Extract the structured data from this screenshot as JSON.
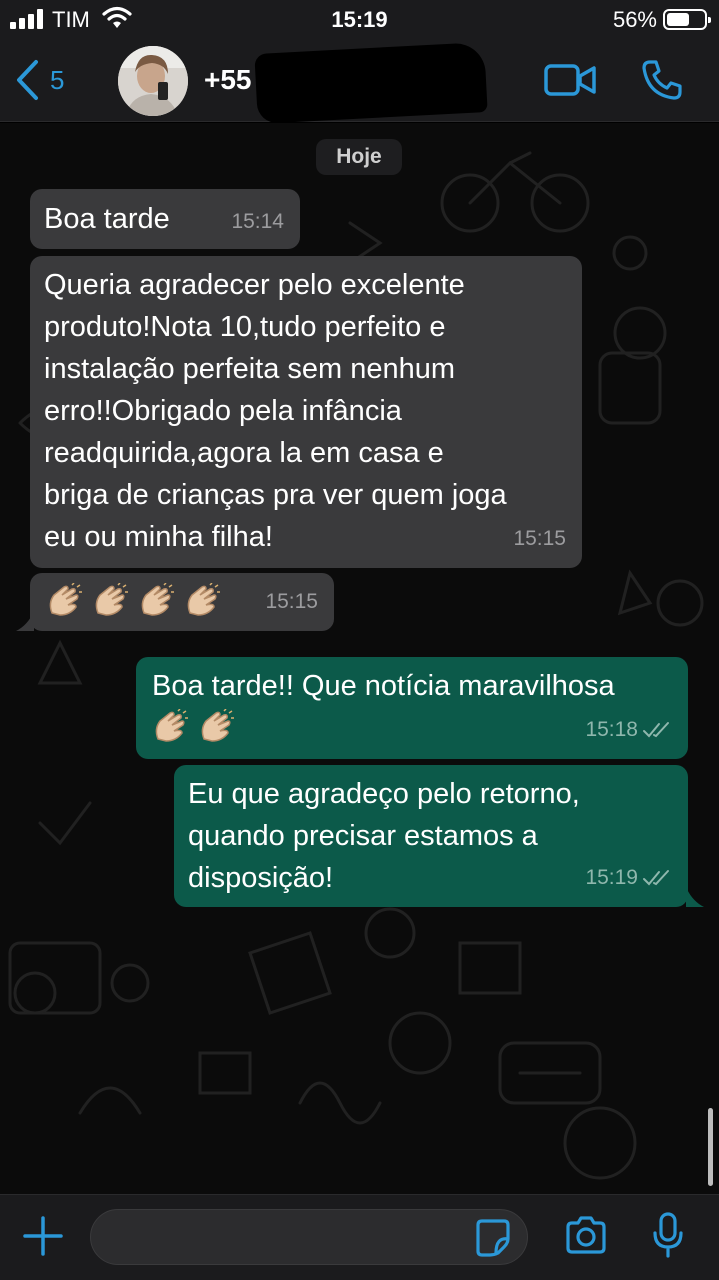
{
  "status_bar": {
    "carrier": "TIM",
    "time": "15:19",
    "battery_percent": "56%",
    "battery_level": 0.56,
    "icons": [
      "signal-icon",
      "wifi-icon",
      "battery-icon"
    ]
  },
  "header": {
    "back_count": "5",
    "contact_name": "+55",
    "icons": [
      "chevron-left-icon",
      "video-call-icon",
      "phone-icon"
    ],
    "accent_color": "#2b98d8"
  },
  "chat": {
    "date_label": "Hoje",
    "messages": [
      {
        "direction": "in",
        "text": "Boa tarde",
        "time": "15:14"
      },
      {
        "direction": "in",
        "text": "Queria agradecer pelo excelente\nproduto!Nota 10,tudo perfeito e\ninstalação perfeita sem nenhum\nerro!!Obrigado pela infância\nreadquirida,agora la em casa e\nbriga de crianças pra ver quem joga\neu ou minha filha!",
        "time": "15:15"
      },
      {
        "direction": "in",
        "text": "👏🏼👏🏼👏🏼👏🏼",
        "emoji": "clapping-hands",
        "emoji_count": 4,
        "time": "15:15"
      },
      {
        "direction": "out",
        "text": "Boa tarde!! Que notícia maravilhosa",
        "emoji": "clapping-hands",
        "emoji_count": 2,
        "time": "15:18",
        "status": "read"
      },
      {
        "direction": "out",
        "text": "Eu que agradeço pelo retorno,\nquando precisar estamos a\ndisposição!",
        "time": "15:19",
        "status": "read"
      }
    ],
    "colors": {
      "incoming_bubble": "#3a3a3c",
      "outgoing_bubble": "#0c5a4a",
      "background": "#0b0b0b"
    }
  },
  "composer": {
    "input_value": "",
    "icons": [
      "plus-icon",
      "sticker-icon",
      "camera-icon",
      "microphone-icon"
    ]
  }
}
